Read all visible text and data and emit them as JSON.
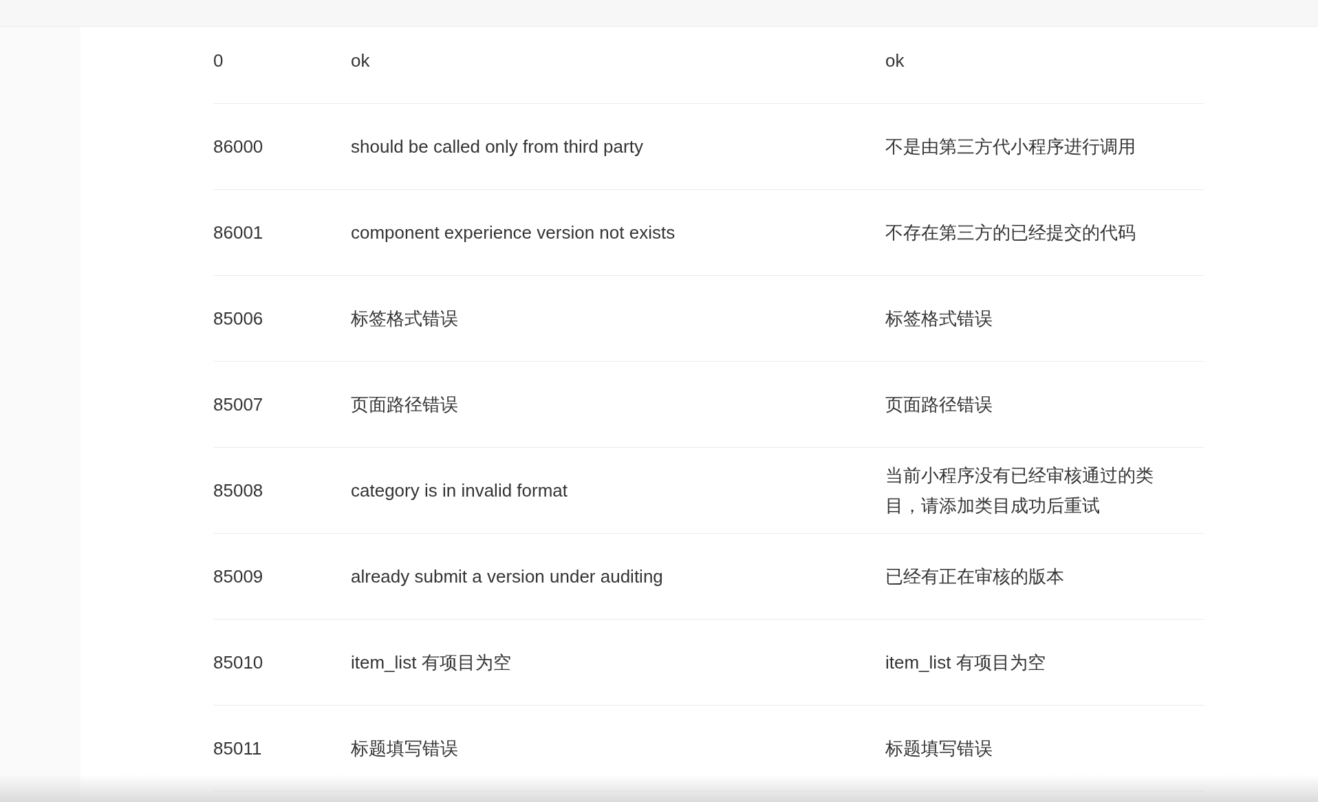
{
  "table": {
    "rows": [
      {
        "column_1": "0",
        "column_2": "ok",
        "column_3": "ok"
      },
      {
        "column_1": "86000",
        "column_2": "should be called only from third party",
        "column_3": "不是由第三方代小程序进行调用"
      },
      {
        "column_1": "86001",
        "column_2": "component experience version not exists",
        "column_3": "不存在第三方的已经提交的代码"
      },
      {
        "column_1": "85006",
        "column_2": "标签格式错误",
        "column_3": "标签格式错误"
      },
      {
        "column_1": "85007",
        "column_2": "页面路径错误",
        "column_3": "页面路径错误"
      },
      {
        "column_1": "85008",
        "column_2": "category is in invalid format",
        "column_3": "当前小程序没有已经审核通过的类目，请添加类目成功后重试"
      },
      {
        "column_1": "85009",
        "column_2": "already submit a version under auditing",
        "column_3": "已经有正在审核的版本"
      },
      {
        "column_1": "85010",
        "column_2": "item_list 有项目为空",
        "column_3": "item_list 有项目为空"
      },
      {
        "column_1": "85011",
        "column_2": "标题填写错误",
        "column_3": "标题填写错误"
      }
    ]
  }
}
